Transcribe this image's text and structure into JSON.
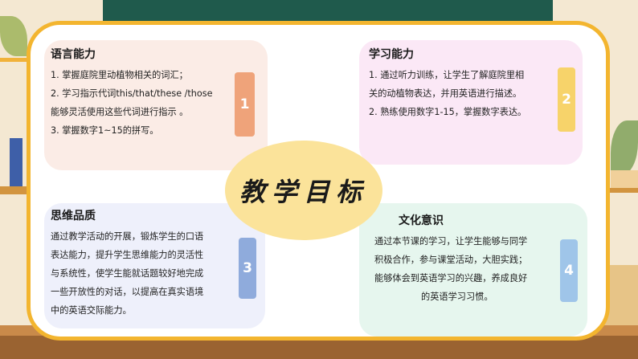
{
  "center_title": "教学目标",
  "cards": [
    {
      "title": "语言能力",
      "lines": [
        "1. 掌握庭院里动植物相关的词汇；",
        "2. 学习指示代词this/that/these /those",
        "能够灵活使用这些代词进行指示 。",
        "3. 掌握数字1~15的拼写。"
      ],
      "number": "1"
    },
    {
      "title": "学习能力",
      "lines": [
        "1. 通过听力训练，让学生了解庭院里相",
        "关的动植物表达，并用英语进行描述。",
        "2. 熟练使用数字1-15，掌握数字表达。"
      ],
      "number": "2"
    },
    {
      "title": "思维品质",
      "lines": [
        "通过教学活动的开展，锻炼学生的口语",
        "表达能力，提升学生思维能力的灵活性",
        "与系统性，使学生能就话题较好地完成",
        "一些开放性的对话，以提高在真实语境",
        "中的英语交际能力。"
      ],
      "number": "3"
    },
    {
      "title": "文化意识",
      "lines": [
        "通过本节课的学习，让学生能够与同学",
        "积极合作，参与课堂活动，大胆实践；",
        "能够体会到英语学习的兴趣，养成良好",
        "的英语学习习惯。"
      ],
      "number": "4"
    }
  ],
  "colors": {
    "frame": "#f3b52f",
    "card_1": "#fbece6",
    "card_2": "#fbe8f6",
    "card_3": "#eef0fb",
    "card_4": "#e6f6ee",
    "tab_1": "#efa37a",
    "tab_2": "#f7d36a",
    "tab_3": "#8fabdc",
    "tab_4": "#9fc5e9",
    "center": "#fbe39a"
  }
}
